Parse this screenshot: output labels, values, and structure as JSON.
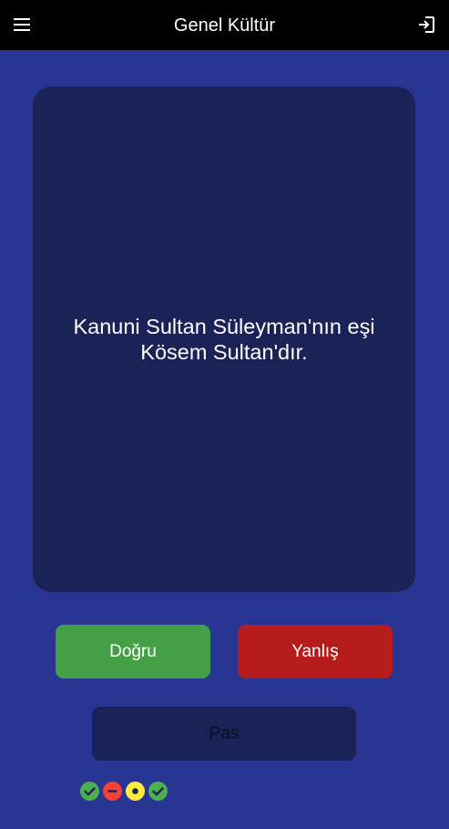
{
  "header": {
    "title": "Genel Kültür",
    "menu_icon": "menu-icon",
    "exit_icon": "exit-icon"
  },
  "question": {
    "text": "Kanuni Sultan Süleyman'nın eşi Kösem Sultan'dır."
  },
  "actions": {
    "true_label": "Doğru",
    "false_label": "Yanlış",
    "pass_label": "Pas"
  },
  "history": [
    {
      "status": "correct",
      "icon": "check-circle-icon",
      "color": "#4caf50"
    },
    {
      "status": "wrong",
      "icon": "minus-circle-icon",
      "color": "#f44336"
    },
    {
      "status": "pass",
      "icon": "dot-circle-icon",
      "color": "#ffeb3b"
    },
    {
      "status": "correct",
      "icon": "check-circle-icon",
      "color": "#4caf50"
    }
  ],
  "colors": {
    "background": "#283593",
    "appbar": "#000000",
    "card": "#1a2257",
    "true_button": "#43a047",
    "false_button": "#b71c1c"
  }
}
